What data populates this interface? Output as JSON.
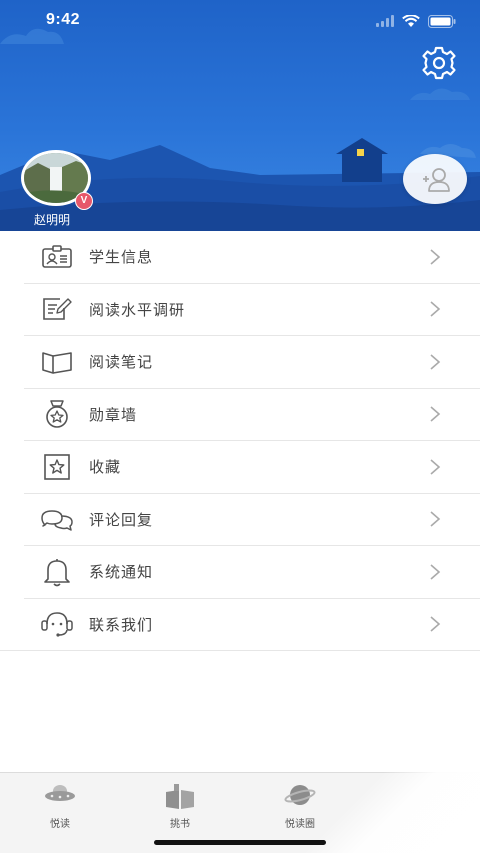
{
  "status_bar": {
    "time": "9:42"
  },
  "profile": {
    "user_name": "赵明明",
    "vip_badge": "V"
  },
  "menu": {
    "items": [
      {
        "label": "学生信息",
        "icon": "id-card-icon"
      },
      {
        "label": "阅读水平调研",
        "icon": "survey-edit-icon"
      },
      {
        "label": "阅读笔记",
        "icon": "open-book-icon"
      },
      {
        "label": "勋章墙",
        "icon": "medal-icon"
      },
      {
        "label": "收藏",
        "icon": "star-favorite-icon"
      },
      {
        "label": "评论回复",
        "icon": "chat-bubbles-icon"
      },
      {
        "label": "系统通知",
        "icon": "bell-icon"
      },
      {
        "label": "联系我们",
        "icon": "headset-support-icon"
      }
    ]
  },
  "tab_bar": {
    "tabs": [
      {
        "label": "悦读",
        "icon": "ufo-icon"
      },
      {
        "label": "挑书",
        "icon": "book-pick-icon"
      },
      {
        "label": "悦读圈",
        "icon": "planet-icon"
      }
    ]
  },
  "colors": {
    "header_blue": "#2a74d8",
    "vip_badge": "#e6576a",
    "text_gray": "#444444"
  }
}
